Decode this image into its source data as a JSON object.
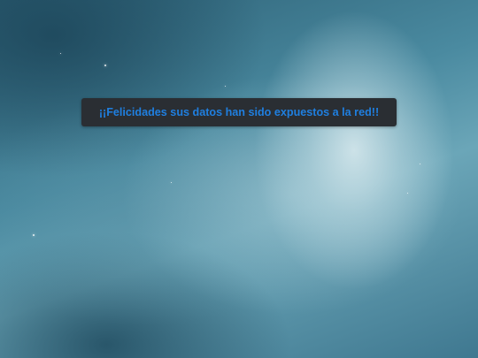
{
  "message": {
    "text": "¡¡Felicidades sus datos han sido expuestos a la red!!",
    "text_color": "#1f7fe0",
    "background_color": "#2a2e33"
  },
  "desktop": {
    "background_colors": [
      "#2c5f74",
      "#4a8aa0",
      "#6ba6b8",
      "#dcecf0"
    ]
  }
}
